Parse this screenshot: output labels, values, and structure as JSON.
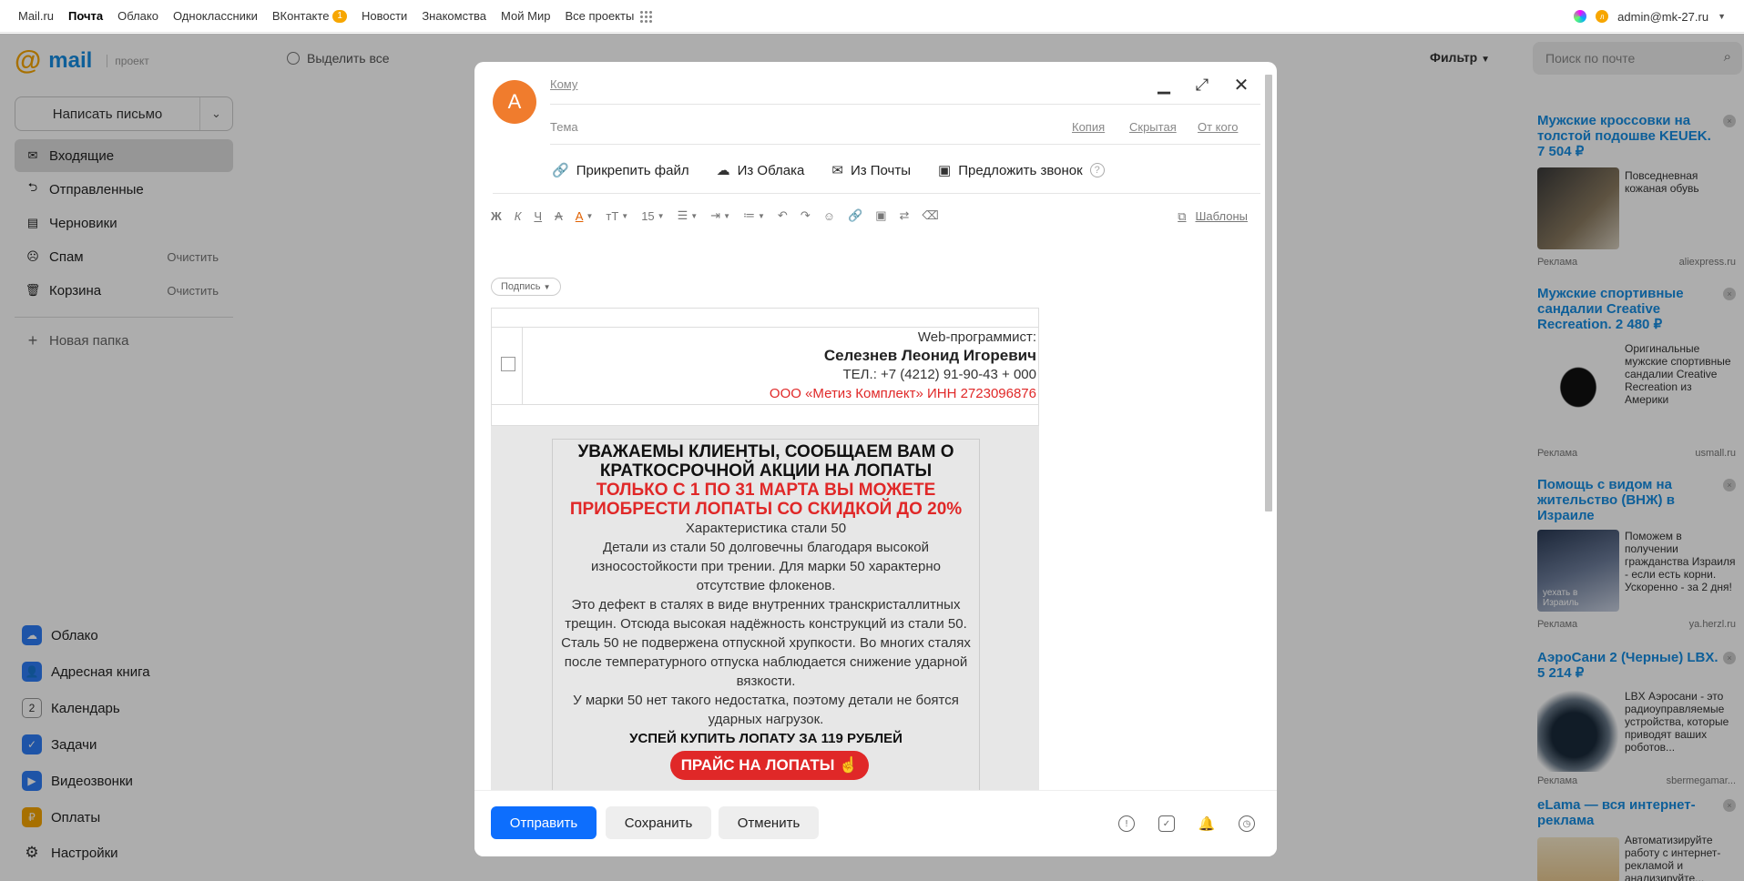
{
  "topnav": {
    "links": [
      "Mail.ru",
      "Почта",
      "Облако",
      "Одноклассники",
      "ВКонтакте",
      "Новости",
      "Знакомства",
      "Мой Мир",
      "Все проекты"
    ],
    "vk_badge": "1",
    "user_initial": "л",
    "user": "admin@mk-27.ru"
  },
  "header": {
    "logo_at": "@",
    "logo_text": "mail",
    "project": "проект",
    "select_all": "Выделить все",
    "filter": "Фильтр",
    "search_placeholder": "Поиск по почте"
  },
  "sidebar": {
    "compose": "Написать письмо",
    "folders": [
      {
        "label": "Входящие"
      },
      {
        "label": "Отправленные"
      },
      {
        "label": "Черновики"
      },
      {
        "label": "Спам",
        "action": "Очистить"
      },
      {
        "label": "Корзина",
        "action": "Очистить"
      }
    ],
    "new_folder": "Новая папка",
    "apps": [
      "Облако",
      "Адресная книга",
      "Календарь",
      "Задачи",
      "Видеозвонки",
      "Оплаты",
      "Настройки"
    ]
  },
  "compose": {
    "avatar_letter": "А",
    "to_label": "Кому",
    "subject_label": "Тема",
    "cc": "Копия",
    "bcc": "Скрытая",
    "from": "От кого",
    "attach": [
      "Прикрепить файл",
      "Из Облака",
      "Из Почты",
      "Предложить звонок"
    ],
    "font_size": "15",
    "templates": "Шаблоны",
    "signature": "Подпись",
    "sig_lines": [
      "Web-программист:",
      "Селезнев Леонид Игоревич",
      "ТЕЛ.: +7 (4212) 91-90-43 + 000",
      "ООО «Метиз Комплект» ИНН 2723096876"
    ],
    "banner": {
      "heading": "УВАЖАЕМЫ КЛИЕНТЫ, СООБЩАЕМ ВАМ О КРАТКОСРОЧНОЙ АКЦИИ НА ЛОПАТЫ",
      "red": "ТОЛЬКО С 1 ПО 31 МАРТА ВЫ МОЖЕТЕ ПРИОБРЕСТИ ЛОПАТЫ СО СКИДКОЙ ДО 20%",
      "p1": "Характеристика стали 50",
      "p2": "Детали из стали 50 долговечны благодаря высокой износостойкости при трении. Для марки 50 характерно отсутствие флокенов.",
      "p3": "Это дефект в сталях в виде внутренних транскристаллитных трещин. Отсюда высокая надёжность конструкций из стали 50.",
      "p4": "Сталь 50 не подвержена отпускной хрупкости. Во многих сталях после температурного отпуска наблюдается снижение ударной вязкости.",
      "p5": "У марки 50 нет такого недостатка, поэтому детали не боятся ударных нагрузок.",
      "bold": "УСПЕЙ КУПИТЬ ЛОПАТУ ЗА 119 РУБЛЕЙ",
      "button": "ПРАЙС НА ЛОПАТЫ"
    },
    "send": "Отправить",
    "save": "Сохранить",
    "cancel": "Отменить"
  },
  "ads": [
    {
      "title": "Мужские кроссовки на толстой подошве KEUEK. 7 504 ₽",
      "desc": "Повседневная кожаная обувь",
      "label": "Реклама",
      "domain": "aliexpress.ru"
    },
    {
      "title": "Мужские спортивные сандалии Creative Recreation. 2 480 ₽",
      "desc": "Оригинальные мужские спортивные сандалии Creative Recreation из Америки",
      "label": "Реклама",
      "domain": "usmall.ru"
    },
    {
      "title": "Помощь с видом на жительство (ВНЖ) в Израиле",
      "desc": "Поможем в получении гражданства Израиля - если есть корни. Ускоренно - за 2 дня!",
      "label": "Реклама",
      "domain": "ya.herzl.ru"
    },
    {
      "title": "АэроСани 2 (Черные) LBX. 5 214 ₽",
      "desc": "LBX Аэросани - это радиоуправляемые устройства, которые приводят ваших роботов...",
      "label": "Реклама",
      "domain": "sbermegamar..."
    },
    {
      "title": "eLama — вся интернет-реклама",
      "desc": "Автоматизируйте работу с интернет-рекламой и анализируйте...",
      "label": "",
      "domain": ""
    }
  ],
  "ad_image_labels": [
    "уехать в Израиль"
  ]
}
